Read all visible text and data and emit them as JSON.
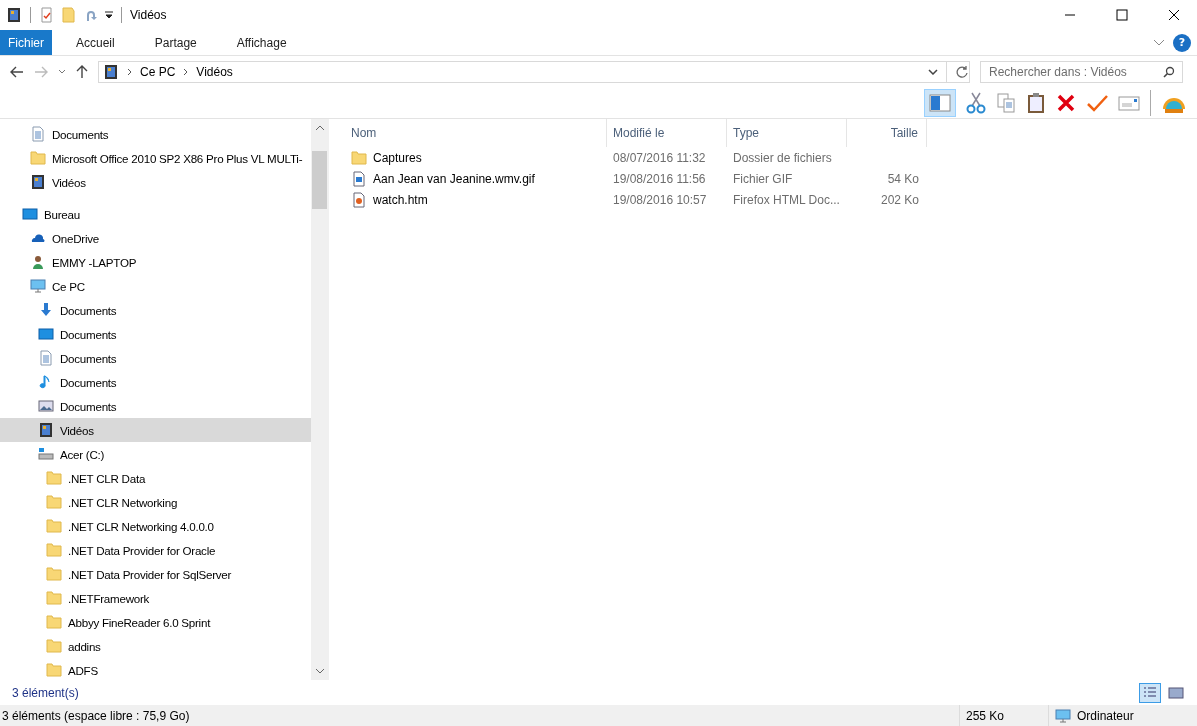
{
  "window": {
    "title": "Vidéos"
  },
  "ribbon_tabs": [
    {
      "label": "Fichier",
      "selected": true
    },
    {
      "label": "Accueil",
      "selected": false
    },
    {
      "label": "Partage",
      "selected": false
    },
    {
      "label": "Affichage",
      "selected": false
    }
  ],
  "address": {
    "crumbs": [
      "Ce PC",
      "Vidéos"
    ]
  },
  "search": {
    "placeholder": "Rechercher dans : Vidéos"
  },
  "help_button": {
    "label": "?"
  },
  "sidebar": {
    "quick_access": [
      {
        "label": "Documents",
        "kind": "doc",
        "selected": false
      },
      {
        "label": "Microsoft Office 2010 SP2 X86 Pro Plus VL MULTi-",
        "kind": "folder",
        "selected": false
      },
      {
        "label": "Vidéos",
        "kind": "video",
        "selected": false
      }
    ],
    "tree": [
      {
        "label": "Bureau",
        "kind": "desktop",
        "selected": false,
        "children": [
          {
            "label": "OneDrive",
            "kind": "cloud",
            "selected": false
          },
          {
            "label": "EMMY -LAPTOP",
            "kind": "user",
            "selected": false
          },
          {
            "label": "Ce PC",
            "kind": "pc",
            "selected": false,
            "children": [
              {
                "label": "Documents",
                "kind": "download",
                "selected": false
              },
              {
                "label": "Documents",
                "kind": "desktop",
                "selected": false
              },
              {
                "label": "Documents",
                "kind": "doc",
                "selected": false
              },
              {
                "label": "Documents",
                "kind": "music",
                "selected": false
              },
              {
                "label": "Documents",
                "kind": "picture",
                "selected": false
              },
              {
                "label": "Vidéos",
                "kind": "video",
                "selected": true
              },
              {
                "label": "Acer (C:)",
                "kind": "drive",
                "selected": false,
                "children": [
                  {
                    "label": ".NET CLR Data",
                    "kind": "folder",
                    "selected": false
                  },
                  {
                    "label": ".NET CLR Networking",
                    "kind": "folder",
                    "selected": false
                  },
                  {
                    "label": ".NET CLR Networking 4.0.0.0",
                    "kind": "folder",
                    "selected": false
                  },
                  {
                    "label": ".NET Data Provider for Oracle",
                    "kind": "folder",
                    "selected": false
                  },
                  {
                    "label": ".NET Data Provider for SqlServer",
                    "kind": "folder",
                    "selected": false
                  },
                  {
                    "label": ".NETFramework",
                    "kind": "folder",
                    "selected": false
                  },
                  {
                    "label": "Abbyy FineReader 6.0 Sprint",
                    "kind": "folder",
                    "selected": false
                  },
                  {
                    "label": "addins",
                    "kind": "folder",
                    "selected": false
                  },
                  {
                    "label": "ADFS",
                    "kind": "folder",
                    "selected": false
                  }
                ]
              }
            ]
          }
        ]
      }
    ]
  },
  "table": {
    "columns": [
      "Nom",
      "Modifié le",
      "Type",
      "Taille"
    ],
    "rows": [
      {
        "kind": "folder",
        "name": "Captures",
        "modified": "08/07/2016 11:32",
        "type": "Dossier de fichiers",
        "selected": false
      },
      {
        "kind": "image",
        "name": "Aan Jean van Jeanine.wmv.gif",
        "modified": "19/08/2016 11:56",
        "type": "Fichier GIF",
        "size": "54 Ko",
        "selected": false
      },
      {
        "kind": "firefox",
        "name": "watch.htm",
        "modified": "19/08/2016 10:57",
        "type": "Firefox HTML Doc...",
        "size": "202 Ko",
        "selected": false
      }
    ]
  },
  "item_count": "3 élément(s)",
  "status_bar": {
    "left": "3 éléments (espace libre : 75,9 Go)",
    "size": "255 Ko",
    "location": "Ordinateur"
  }
}
